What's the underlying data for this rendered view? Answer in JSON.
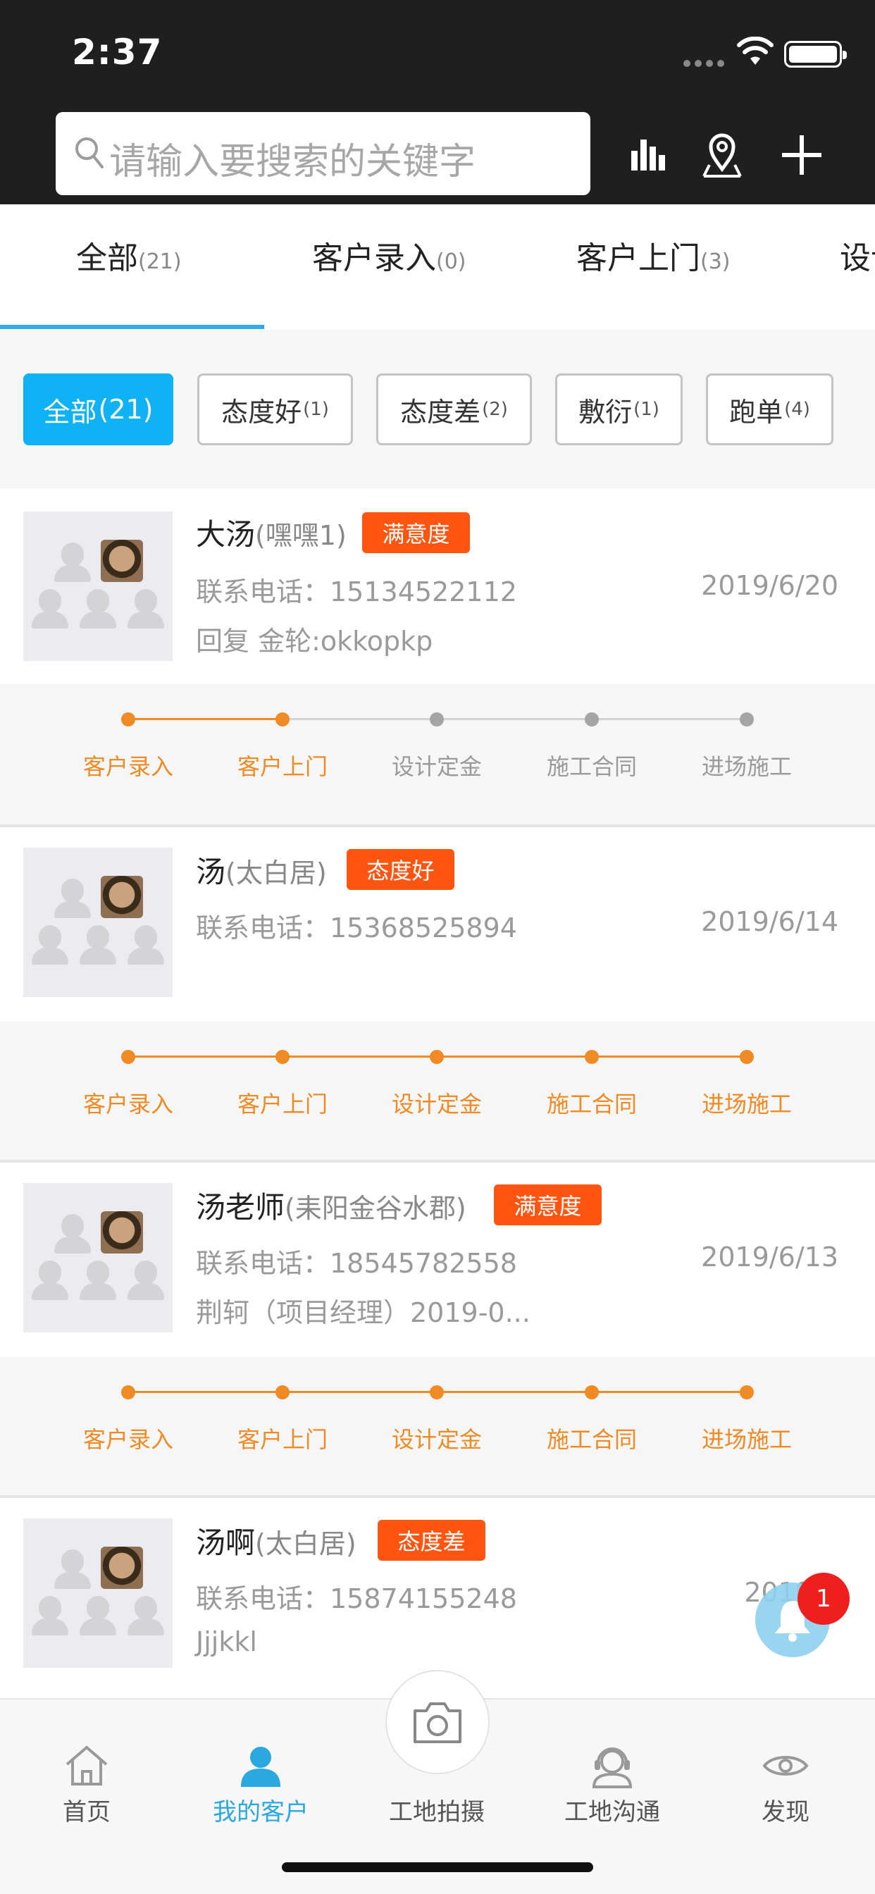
{
  "status": {
    "time": "2:37"
  },
  "header": {
    "search_placeholder": "请输入要搜索的关键字",
    "icons": [
      "bar-chart-icon",
      "map-pin-icon",
      "plus-icon"
    ]
  },
  "tabs": [
    {
      "label": "全部",
      "count": "(21)"
    },
    {
      "label": "客户录入",
      "count": "(0)"
    },
    {
      "label": "客户上门",
      "count": "(3)"
    },
    {
      "label": "设计",
      "count": ""
    }
  ],
  "filters": [
    {
      "label": "全部",
      "count": "(21)"
    },
    {
      "label": "态度好",
      "count": "(1)"
    },
    {
      "label": "态度差",
      "count": "(2)"
    },
    {
      "label": "敷衍",
      "count": "(1)"
    },
    {
      "label": "跑单",
      "count": "(4)"
    }
  ],
  "stages": [
    "客户录入",
    "客户上门",
    "设计定金",
    "施工合同",
    "进场施工"
  ],
  "customers": [
    {
      "name": "大汤",
      "project": "(嘿嘿1)",
      "badge": "满意度",
      "phone": "联系电话：15134522112",
      "date": "2019/6/20",
      "note": "回复 金轮:okkopkp",
      "progress": 2
    },
    {
      "name": "汤",
      "project": "(太白居)",
      "badge": "态度好",
      "phone": "联系电话：15368525894",
      "date": "2019/6/14",
      "note": "",
      "progress": 5
    },
    {
      "name": "汤老师",
      "project": "(耒阳金谷水郡)",
      "badge": "满意度",
      "phone": "联系电话：18545782558",
      "date": "2019/6/13",
      "note": "荆轲（项目经理）2019-0...",
      "progress": 5
    },
    {
      "name": "汤啊",
      "project": "(太白居)",
      "badge": "态度差",
      "phone": "联系电话：15874155248",
      "date": "2019/6",
      "note": "Jjjkkl",
      "progress": 0
    }
  ],
  "notification": {
    "count": "1"
  },
  "nav": [
    {
      "label": "首页",
      "icon": "home-icon"
    },
    {
      "label": "我的客户",
      "icon": "user-icon"
    },
    {
      "label": "工地拍摄",
      "icon": "camera-icon"
    },
    {
      "label": "工地沟通",
      "icon": "headset-icon"
    },
    {
      "label": "发现",
      "icon": "eye-icon"
    }
  ],
  "colors": {
    "accent": "#0fb2f4",
    "orange": "#f08a24",
    "badge": "#ff5510",
    "header": "#1f1f1f"
  }
}
